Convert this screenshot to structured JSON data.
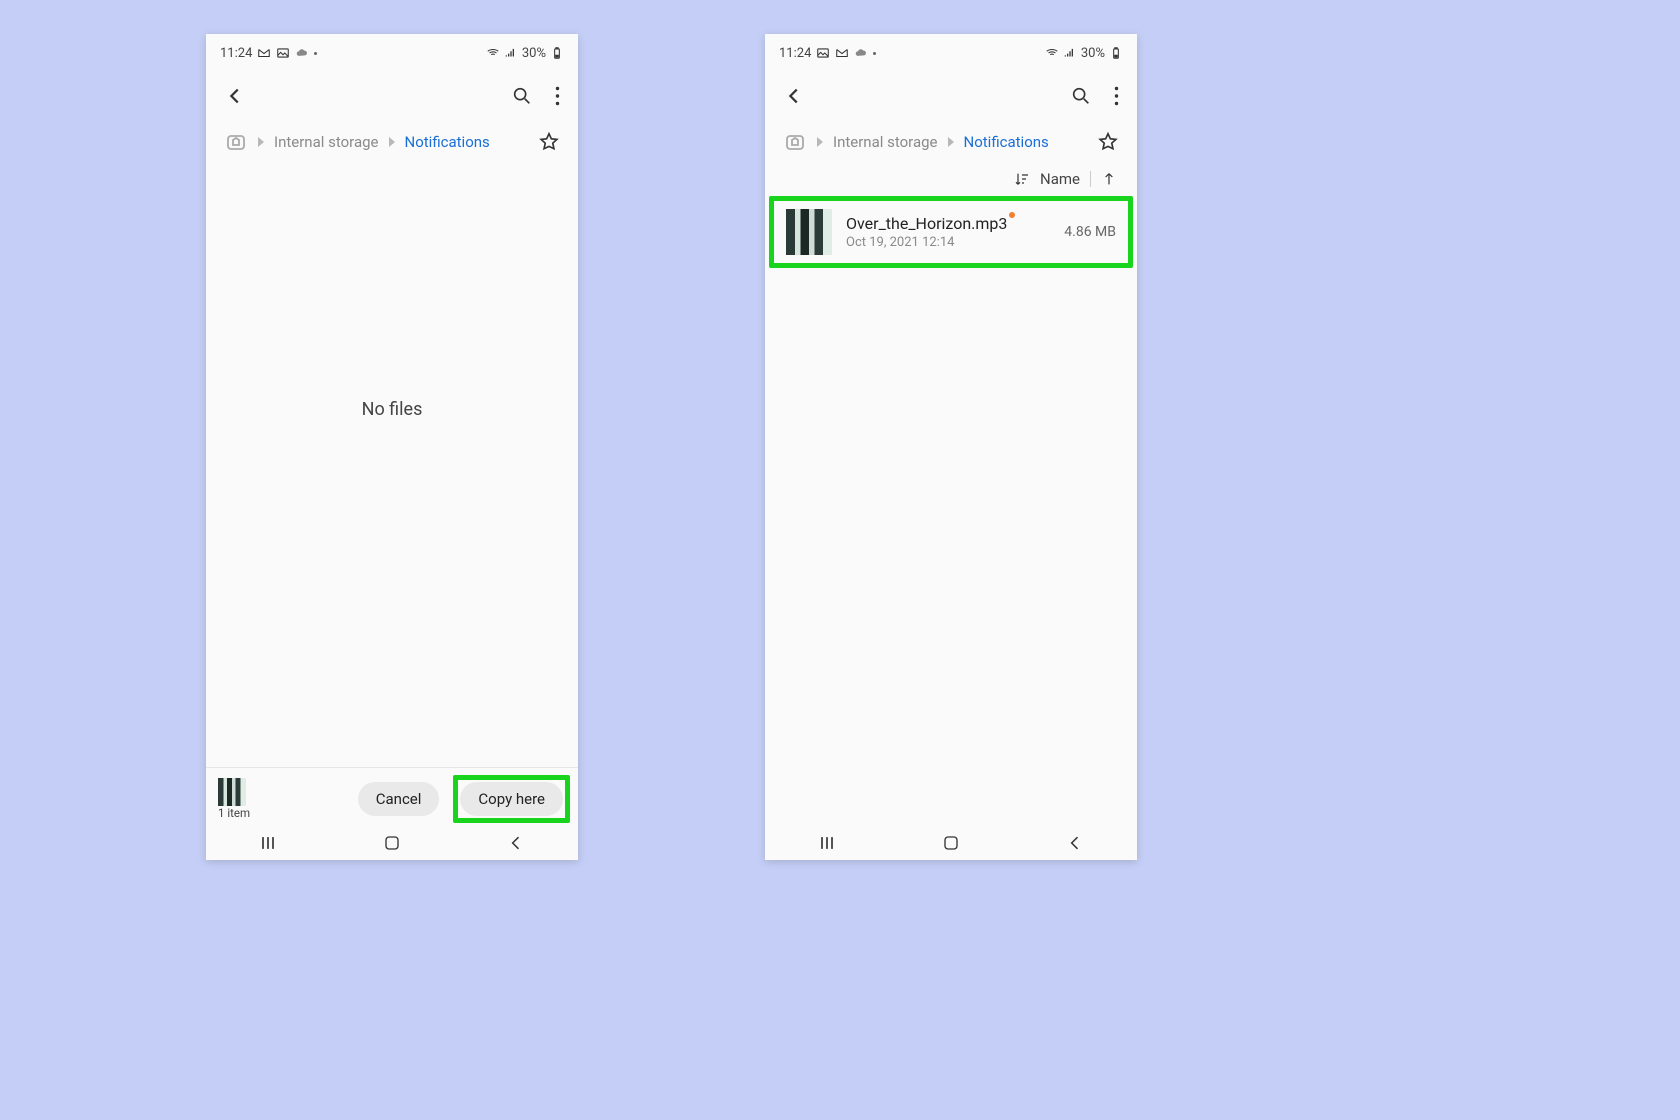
{
  "status": {
    "time": "11:24",
    "battery": "30%"
  },
  "breadcrumb": {
    "storage": "Internal storage",
    "folder": "Notifications"
  },
  "left": {
    "empty": "No files",
    "item_count": "1 item",
    "cancel": "Cancel",
    "copy": "Copy here"
  },
  "right": {
    "sort_label": "Name",
    "file": {
      "name": "Over_the_Horizon.mp3",
      "date": "Oct 19, 2021 12:14",
      "size": "4.86 MB"
    }
  }
}
